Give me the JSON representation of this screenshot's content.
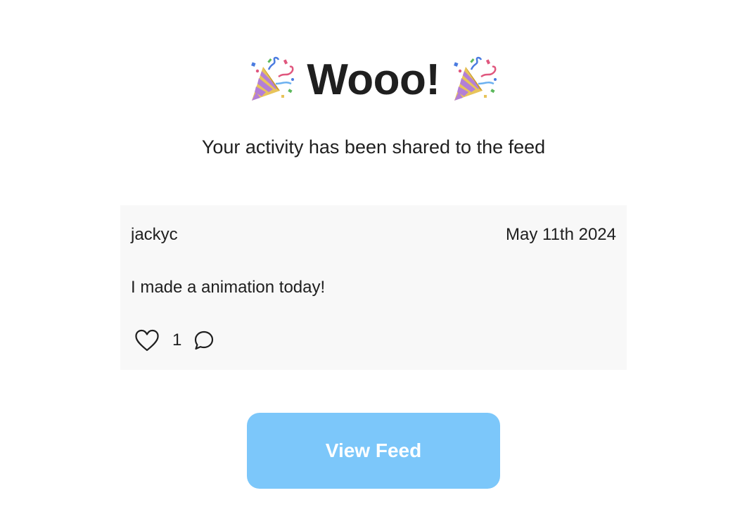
{
  "heading": {
    "title": "Wooo!",
    "left_icon": "party-popper-icon",
    "right_icon": "party-popper-icon"
  },
  "subtitle": "Your activity has been shared to the feed",
  "post": {
    "username": "jackyc",
    "date": "May 11th 2024",
    "body": "I made a animation today!",
    "like_icon": "heart-outline-icon",
    "like_count": "1",
    "comment_icon": "speech-bubble-icon"
  },
  "action": {
    "view_feed_label": "View Feed"
  },
  "colors": {
    "button_background": "#7cc7fa",
    "button_text": "#ffffff",
    "card_background": "#f8f8f8",
    "text": "#1f1f1f"
  }
}
